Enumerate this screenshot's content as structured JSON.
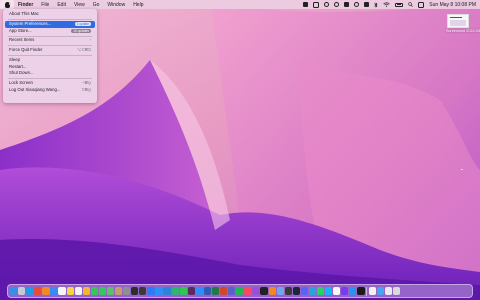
{
  "menubar": {
    "apple_icon": "apple-logo-icon",
    "items": [
      "Finder",
      "File",
      "Edit",
      "View",
      "Go",
      "Window",
      "Help"
    ],
    "clock": "Sun May 8  10:08 PM",
    "status_icons": [
      "script-editor-icon",
      "notes-icon",
      "creative-cloud-icon",
      "timer-icon",
      "screen-record-icon",
      "headphones-icon",
      "grid-icon",
      "bluetooth-icon",
      "wifi-icon",
      "battery-icon",
      "search-icon",
      "control-center-icon"
    ]
  },
  "apple_menu": {
    "items": [
      {
        "label": "About This Mac",
        "shortcut": ""
      },
      {
        "label": "System Preferences...",
        "badge": "1 update"
      },
      {
        "label": "App Store...",
        "badge": "10 updates"
      },
      {
        "label": "Recent Items",
        "shortcut": "›"
      },
      {
        "label": "Force Quit Finder",
        "shortcut": "⌥⇧⌘⎋"
      },
      {
        "label": "Sleep",
        "shortcut": ""
      },
      {
        "label": "Restart...",
        "shortcut": ""
      },
      {
        "label": "Shut Down...",
        "shortcut": ""
      },
      {
        "label": "Lock Screen",
        "shortcut": "^⌘Q"
      },
      {
        "label": "Log Out Xiaoqiang Wang...",
        "shortcut": "⇧⌘Q"
      }
    ]
  },
  "desktop_icon": {
    "label": "Screenshot 2022-05-08 at ...",
    "icon": "screenshot-file-icon"
  },
  "colors": {
    "menubar": "#eccee2",
    "menu_highlight": "#2f6ce0",
    "wall_base": "#a13fd4"
  },
  "dock": {
    "apps": [
      {
        "icon": "finder-icon",
        "color": "#3b8ee8"
      },
      {
        "icon": "launchpad-icon",
        "color": "#c9c9d6"
      },
      {
        "icon": "safari-icon",
        "color": "#1f9bea"
      },
      {
        "icon": "chrome-icon",
        "color": "#e84a3b"
      },
      {
        "icon": "firefox-icon",
        "color": "#f18a25"
      },
      {
        "icon": "mail-icon",
        "color": "#3a8bf0"
      },
      {
        "icon": "calendar-icon",
        "color": "#f5f5f5"
      },
      {
        "icon": "notes-icon",
        "color": "#f7d44a"
      },
      {
        "icon": "reminders-icon",
        "color": "#f3f3f3"
      },
      {
        "icon": "photos-icon",
        "color": "#f2b33a"
      },
      {
        "icon": "facetime-icon",
        "color": "#38c559"
      },
      {
        "icon": "messages-icon",
        "color": "#35c85a"
      },
      {
        "icon": "maps-icon",
        "color": "#5fbe6c"
      },
      {
        "icon": "contacts-icon",
        "color": "#c89b6a"
      },
      {
        "icon": "system-preferences-icon",
        "color": "#8e8e93"
      },
      {
        "icon": "terminal-icon",
        "color": "#2d2d2d"
      },
      {
        "icon": "activity-monitor-icon",
        "color": "#3a3a3a"
      },
      {
        "icon": "app-store-icon",
        "color": "#2a7bf5"
      },
      {
        "icon": "xcode-icon",
        "color": "#2f8ff7"
      },
      {
        "icon": "vscode-icon",
        "color": "#2c84d8"
      },
      {
        "icon": "pycharm-icon",
        "color": "#2bb673"
      },
      {
        "icon": "wechat-icon",
        "color": "#2ec84f"
      },
      {
        "icon": "slack-icon",
        "color": "#5a2a5f"
      },
      {
        "icon": "zoom-icon",
        "color": "#2d8cff"
      },
      {
        "icon": "word-icon",
        "color": "#2b5fb3"
      },
      {
        "icon": "excel-icon",
        "color": "#1f7a45"
      },
      {
        "icon": "powerpoint-icon",
        "color": "#d24726"
      },
      {
        "icon": "teams-icon",
        "color": "#5b5fc7"
      },
      {
        "icon": "spotify-icon",
        "color": "#1db954"
      },
      {
        "icon": "music-icon",
        "color": "#fb4a60"
      },
      {
        "icon": "podcasts-icon",
        "color": "#9b4fd8"
      },
      {
        "icon": "tv-icon",
        "color": "#222222"
      },
      {
        "icon": "books-icon",
        "color": "#f5891f"
      },
      {
        "icon": "preview-icon",
        "color": "#6ea8e8"
      },
      {
        "icon": "calculator-icon",
        "color": "#3a3a3a"
      },
      {
        "icon": "steam-icon",
        "color": "#1b2838"
      },
      {
        "icon": "discord-icon",
        "color": "#5865f2"
      },
      {
        "icon": "telegram-icon",
        "color": "#2aa3dd"
      },
      {
        "icon": "whatsapp-icon",
        "color": "#25d366"
      },
      {
        "icon": "qq-icon",
        "color": "#12b7f5"
      },
      {
        "icon": "notion-icon",
        "color": "#f7f7f7"
      },
      {
        "icon": "obsidian-icon",
        "color": "#7c3aed"
      },
      {
        "icon": "docker-icon",
        "color": "#2496ed"
      },
      {
        "icon": "iterm-icon",
        "color": "#1a1a1a"
      }
    ],
    "recents": [
      {
        "icon": "textedit-icon",
        "color": "#f2f2f2"
      },
      {
        "icon": "downloads-folder-icon",
        "color": "#4aa3f0"
      },
      {
        "icon": "screenshot-stack-icon",
        "color": "#e9e9ef"
      },
      {
        "icon": "trash-icon",
        "color": "#d9d9de"
      }
    ]
  }
}
